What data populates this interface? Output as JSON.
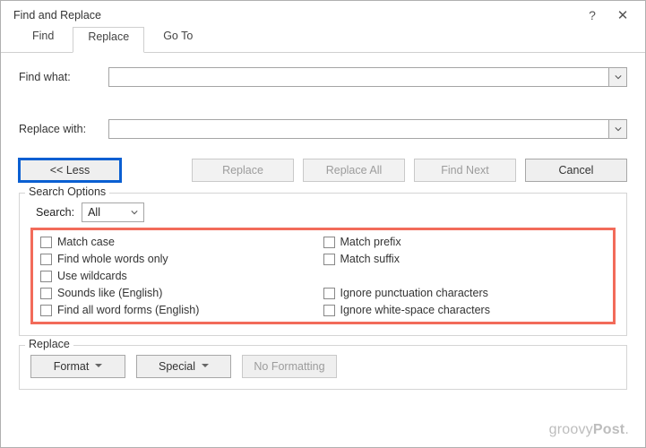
{
  "title": "Find and Replace",
  "titlebar": {
    "help": "?",
    "close": "✕"
  },
  "tabs": {
    "find": "Find",
    "replace": "Replace",
    "goto": "Go To",
    "active": "replace"
  },
  "labels": {
    "find_what": "Find what:",
    "replace_with": "Replace with:"
  },
  "fields": {
    "find_what_value": "",
    "replace_with_value": ""
  },
  "buttons": {
    "less": "<< Less",
    "replace": "Replace",
    "replace_all": "Replace All",
    "find_next": "Find Next",
    "cancel": "Cancel"
  },
  "search_options": {
    "legend": "Search Options",
    "search_label": "Search:",
    "search_value": "All",
    "checks": {
      "match_case": "Match case",
      "whole_words": "Find whole words only",
      "use_wildcards": "Use wildcards",
      "sounds_like": "Sounds like (English)",
      "word_forms": "Find all word forms (English)",
      "match_prefix": "Match prefix",
      "match_suffix": "Match suffix",
      "ignore_punct": "Ignore punctuation characters",
      "ignore_ws": "Ignore white-space characters"
    }
  },
  "replace_group": {
    "legend": "Replace",
    "format": "Format",
    "special": "Special",
    "no_formatting": "No Formatting"
  },
  "watermark": {
    "a": "groovy",
    "b": "Post"
  }
}
